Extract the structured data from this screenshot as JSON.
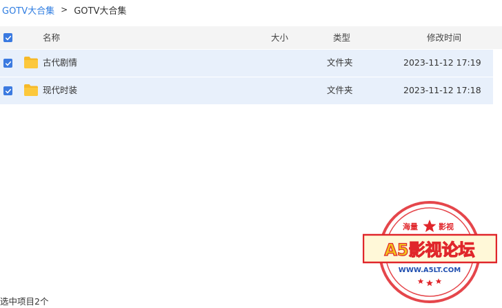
{
  "breadcrumb": {
    "root": "GOTV大合集",
    "separator": ">",
    "current": "GOTV大合集"
  },
  "table": {
    "columns": {
      "name": "名称",
      "size": "大小",
      "type": "类型",
      "modified": "修改时间"
    },
    "rows": [
      {
        "name": "古代剧情",
        "size": "",
        "type": "文件夹",
        "modified": "2023-11-12 17:19",
        "checked": true,
        "icon": "folder-icon"
      },
      {
        "name": "现代时装",
        "size": "",
        "type": "文件夹",
        "modified": "2023-11-12 17:18",
        "checked": true,
        "icon": "folder-icon"
      }
    ]
  },
  "status": {
    "selection": "选中项目2个"
  },
  "watermark": {
    "top_text": "海量",
    "top_text_right": "影视",
    "main_text": "A5影视论坛",
    "url": "WWW.A5LT.COM"
  },
  "colors": {
    "accent": "#3b7ae0",
    "link": "#2f7de1",
    "row_selected": "#e8f0fb",
    "header_bg": "#f4f4f4",
    "folder": "#f8c23a",
    "stamp_red": "#e0262b"
  }
}
